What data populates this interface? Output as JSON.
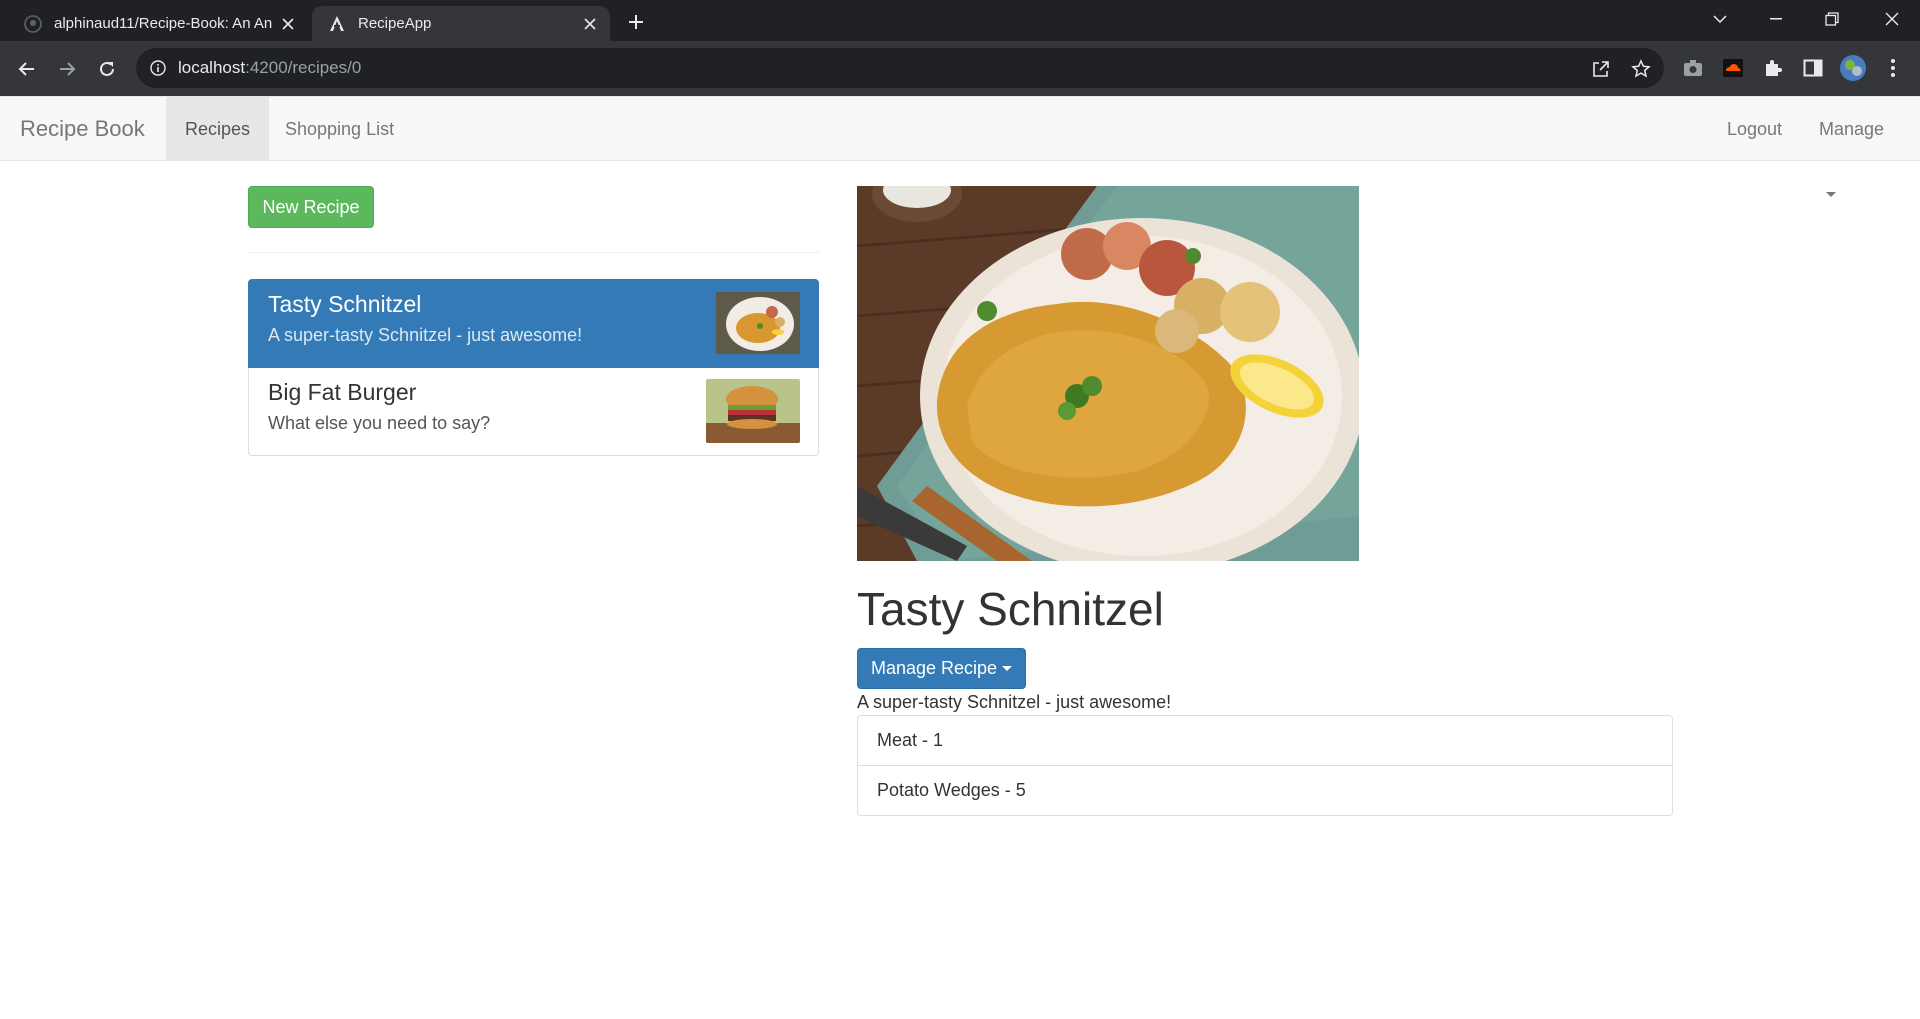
{
  "browser": {
    "tabs": [
      {
        "title": "alphinaud11/Recipe-Book: An An",
        "active": false,
        "icon": "github-icon"
      },
      {
        "title": "RecipeApp",
        "active": true,
        "icon": "angular-icon"
      }
    ],
    "address": {
      "host": "localhost",
      "path": ":4200/recipes/0"
    }
  },
  "navbar": {
    "brand": "Recipe Book",
    "links": [
      {
        "label": "Recipes",
        "active": true
      },
      {
        "label": "Shopping List",
        "active": false
      }
    ],
    "right": {
      "logout": "Logout",
      "manage": "Manage"
    }
  },
  "recipes_panel": {
    "new_button": "New Recipe",
    "items": [
      {
        "name": "Tasty Schnitzel",
        "description": "A super-tasty Schnitzel - just awesome!",
        "active": true
      },
      {
        "name": "Big Fat Burger",
        "description": "What else you need to say?",
        "active": false
      }
    ]
  },
  "detail": {
    "title": "Tasty Schnitzel",
    "manage_button": "Manage Recipe",
    "description": "A super-tasty Schnitzel - just awesome!",
    "ingredients": [
      "Meat - 1",
      "Potato Wedges - 5"
    ]
  },
  "colors": {
    "primary": "#337ab7",
    "success": "#5cb85c",
    "navbar_bg": "#f8f8f8",
    "chrome_dark": "#202124",
    "chrome_toolbar": "#35363a"
  }
}
